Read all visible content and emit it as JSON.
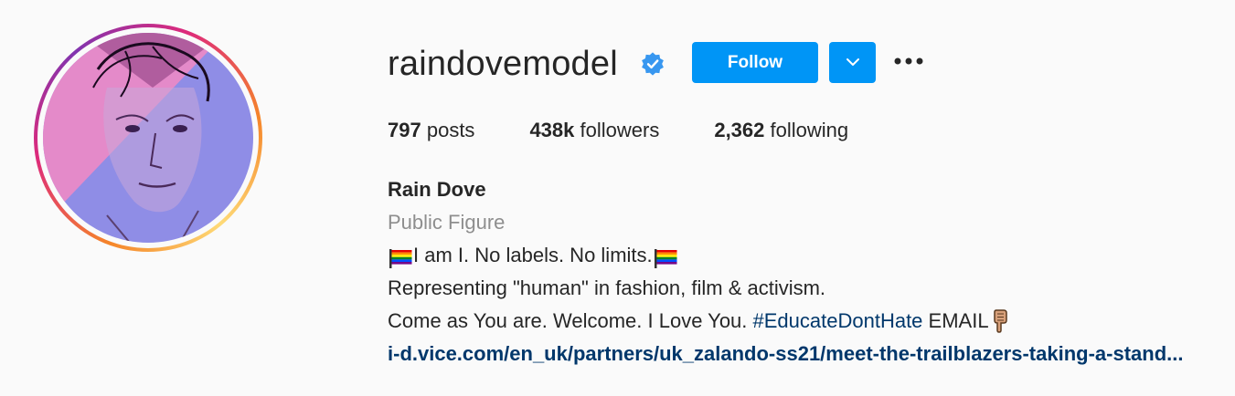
{
  "profile": {
    "username": "raindovemodel",
    "verified": true,
    "follow_label": "Follow",
    "accent_color": "#0095f6"
  },
  "stats": {
    "posts_count": "797",
    "posts_label": "posts",
    "followers_count": "438k",
    "followers_label": "followers",
    "following_count": "2,362",
    "following_label": "following"
  },
  "bio": {
    "full_name": "Rain Dove",
    "category": "Public Figure",
    "line1_text": "I am I. No labels. No limits.",
    "line1_icons": [
      "rainbow-flag-icon",
      "rainbow-flag-icon"
    ],
    "line2_text": "Representing \"human\" in fashion, film & activism.",
    "line3_text": "Come as You are. Welcome. I Love You. ",
    "line3_hashtag": "#EducateDontHate",
    "line3_suffix": " EMAIL",
    "line3_icon": "pointing-down-hand-icon",
    "link": "i-d.vice.com/en_uk/partners/uk_zalando-ss21/meet-the-trailblazers-taking-a-stand..."
  },
  "icons": {
    "verified": "verified-badge-icon",
    "dropdown": "chevron-down-icon",
    "more": "more-options-icon"
  }
}
